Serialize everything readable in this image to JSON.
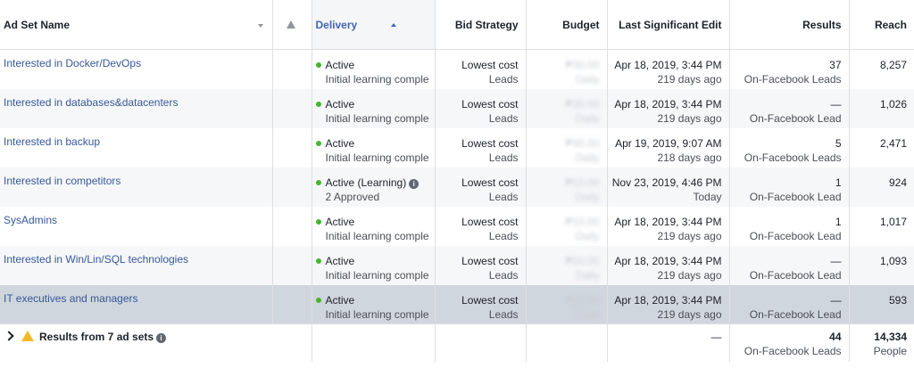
{
  "headers": {
    "ad_set_name": "Ad Set Name",
    "delivery": "Delivery",
    "bid_strategy": "Bid Strategy",
    "budget": "Budget",
    "last_edit": "Last Significant Edit",
    "results": "Results",
    "reach": "Reach"
  },
  "rows": [
    {
      "name": "Interested in Docker/DevOps",
      "status": "Active",
      "status_sub": "Initial learning comple",
      "bid": "Lowest cost",
      "bid_sub": "Leads",
      "budget": "₱30.00",
      "budget_sub": "Daily",
      "edit": "Apr 18, 2019, 3:44 PM",
      "edit_sub": "219 days ago",
      "results": "37",
      "results_sub": "On-Facebook Leads",
      "reach": "8,257"
    },
    {
      "name": "Interested in databases&datacenters",
      "status": "Active",
      "status_sub": "Initial learning comple",
      "bid": "Lowest cost",
      "bid_sub": "Leads",
      "budget": "₱20.00",
      "budget_sub": "Daily",
      "edit": "Apr 18, 2019, 3:44 PM",
      "edit_sub": "219 days ago",
      "results": "—",
      "results_sub": "On-Facebook Lead",
      "reach": "1,026"
    },
    {
      "name": "Interested in backup",
      "status": "Active",
      "status_sub": "Initial learning comple",
      "bid": "Lowest cost",
      "bid_sub": "Leads",
      "budget": "₱30.00",
      "budget_sub": "Daily",
      "edit": "Apr 19, 2019, 9:07 AM",
      "edit_sub": "218 days ago",
      "results": "5",
      "results_sub": "On-Facebook Leads",
      "reach": "2,471"
    },
    {
      "name": "Interested in competitors",
      "status": "Active (Learning)",
      "status_sub": "2 Approved",
      "bid": "Lowest cost",
      "bid_sub": "Leads",
      "budget": "₱10.00",
      "budget_sub": "Daily",
      "edit": "Nov 23, 2019, 4:46 PM",
      "edit_sub": "Today",
      "results": "1",
      "results_sub": "On-Facebook Lead",
      "reach": "924"
    },
    {
      "name": "SysAdmins",
      "status": "Active",
      "status_sub": "Initial learning comple",
      "bid": "Lowest cost",
      "bid_sub": "Leads",
      "budget": "₱10.00",
      "budget_sub": "Daily",
      "edit": "Apr 18, 2019, 3:44 PM",
      "edit_sub": "219 days ago",
      "results": "1",
      "results_sub": "On-Facebook Lead",
      "reach": "1,017"
    },
    {
      "name": "Interested in Win/Lin/SQL technologies",
      "status": "Active",
      "status_sub": "Initial learning comple",
      "bid": "Lowest cost",
      "bid_sub": "Leads",
      "budget": "₱20.00",
      "budget_sub": "Daily",
      "edit": "Apr 18, 2019, 3:44 PM",
      "edit_sub": "219 days ago",
      "results": "—",
      "results_sub": "On-Facebook Lead",
      "reach": "1,093"
    },
    {
      "name": "IT executives and managers",
      "status": "Active",
      "status_sub": "Initial learning comple",
      "bid": "Lowest cost",
      "bid_sub": "Leads",
      "budget": "₱20.00",
      "budget_sub": "Daily",
      "edit": "Apr 18, 2019, 3:44 PM",
      "edit_sub": "219 days ago",
      "results": "—",
      "results_sub": "On-Facebook Lead",
      "reach": "593"
    }
  ],
  "summary": {
    "label": "Results from 7 ad sets",
    "last_edit": "—",
    "results": "44",
    "results_sub": "On-Facebook Leads",
    "reach": "14,334",
    "reach_sub": "People"
  },
  "icons": {
    "info": "i"
  },
  "colors": {
    "link": "#365899",
    "active_dot": "#42b72a",
    "selected_row": "#cfd6de",
    "warning": "#f7b928"
  }
}
